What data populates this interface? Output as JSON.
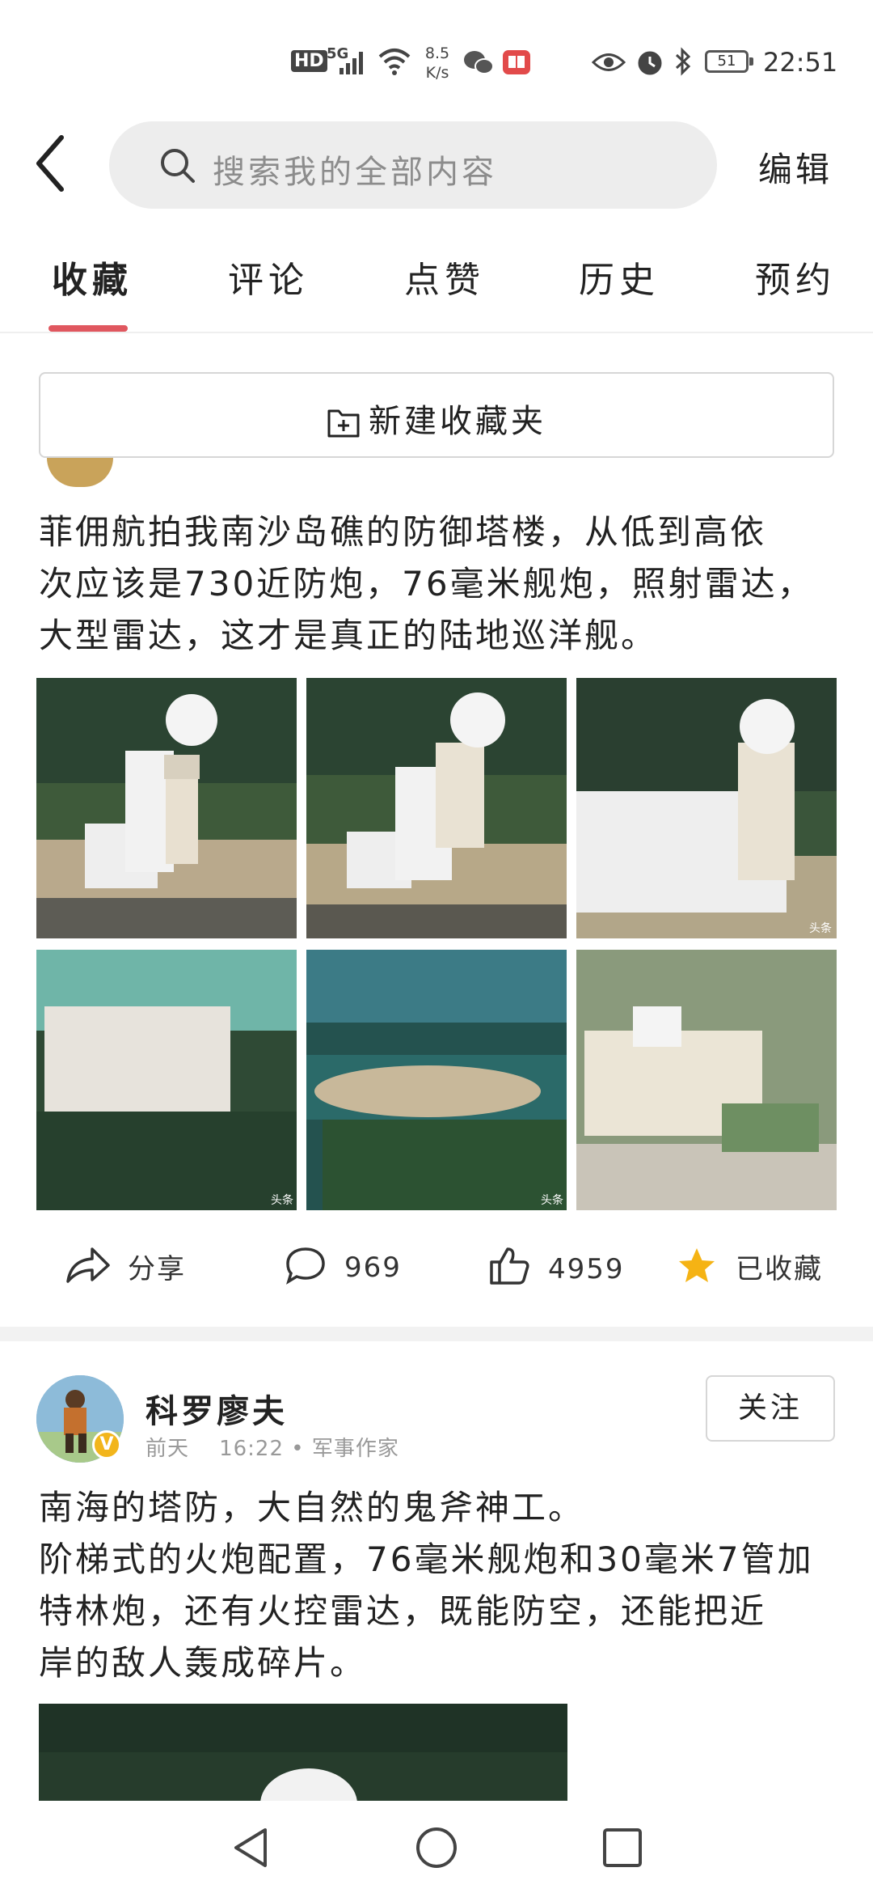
{
  "status_bar": {
    "hd": "HD",
    "signal": "5G",
    "net_speed_value": "8.5",
    "net_speed_unit": "K/s",
    "battery": "51",
    "time": "22:51"
  },
  "header": {
    "search_placeholder": "搜索我的全部内容",
    "edit_label": "编辑"
  },
  "tabs": [
    {
      "label": "收藏",
      "active": true
    },
    {
      "label": "评论"
    },
    {
      "label": "点赞"
    },
    {
      "label": "历史"
    },
    {
      "label": "预约"
    }
  ],
  "new_folder_label": "新建收藏夹",
  "post1": {
    "text_lines": [
      "菲佣航拍我南沙岛礁的防御塔楼，从低到高依",
      "次应该是730近防炮，76毫米舰炮，照射雷达，",
      "大型雷达，这才是真正的陆地巡洋舰。"
    ],
    "image_watermark": "头条",
    "share_label": "分享",
    "comments": "969",
    "likes": "4959",
    "favorited_label": "已收藏"
  },
  "post2": {
    "author": "科罗廖夫",
    "badge": "V",
    "date": "前天",
    "time": "16:22",
    "category": "军事作家",
    "follow_label": "关注",
    "text_lines": [
      "南海的塔防，大自然的鬼斧神工。",
      "阶梯式的火炮配置，76毫米舰炮和30毫米7管加",
      "特林炮，还有火控雷达，既能防空，还能把近",
      "岸的敌人轰成碎片。"
    ]
  },
  "colors": {
    "accent": "#e0575f",
    "star": "#f5b314",
    "badge": "#f2b51c"
  }
}
